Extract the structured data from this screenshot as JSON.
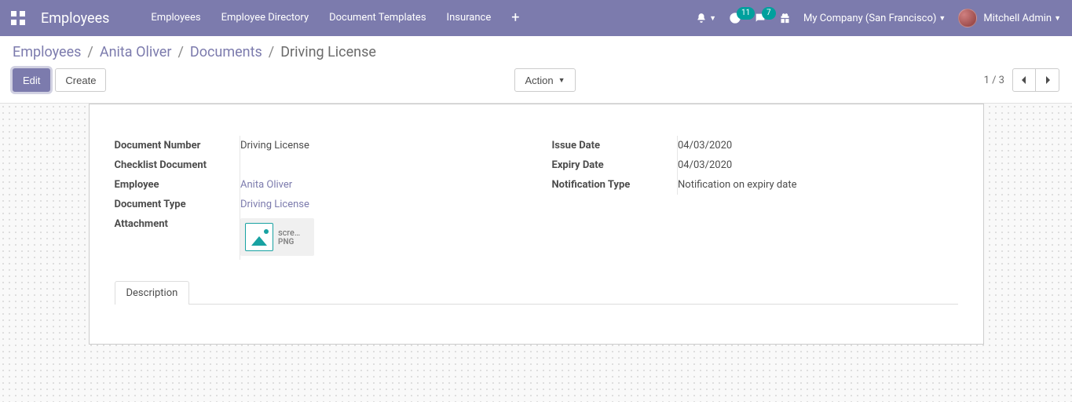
{
  "navbar": {
    "brand": "Employees",
    "links": [
      "Employees",
      "Employee Directory",
      "Document Templates",
      "Insurance"
    ],
    "badge_activities": "11",
    "badge_messages": "7",
    "company": "My Company (San Francisco)",
    "user": "Mitchell Admin"
  },
  "breadcrumb": {
    "root": "Employees",
    "employee": "Anita Oliver",
    "section": "Documents",
    "current": "Driving License"
  },
  "buttons": {
    "edit": "Edit",
    "create": "Create",
    "action": "Action"
  },
  "pager": {
    "text": "1 / 3"
  },
  "fields": {
    "left": {
      "document_number": {
        "label": "Document Number",
        "value": "Driving License"
      },
      "checklist_document": {
        "label": "Checklist Document",
        "value": ""
      },
      "employee": {
        "label": "Employee",
        "value": "Anita Oliver"
      },
      "document_type": {
        "label": "Document Type",
        "value": "Driving License"
      },
      "attachment": {
        "label": "Attachment",
        "file_name": "scre…",
        "file_ext": "png"
      }
    },
    "right": {
      "issue_date": {
        "label": "Issue Date",
        "value": "04/03/2020"
      },
      "expiry_date": {
        "label": "Expiry Date",
        "value": "04/03/2020"
      },
      "notification_type": {
        "label": "Notification Type",
        "value": "Notification on expiry date"
      }
    }
  },
  "tabs": {
    "description": "Description"
  }
}
